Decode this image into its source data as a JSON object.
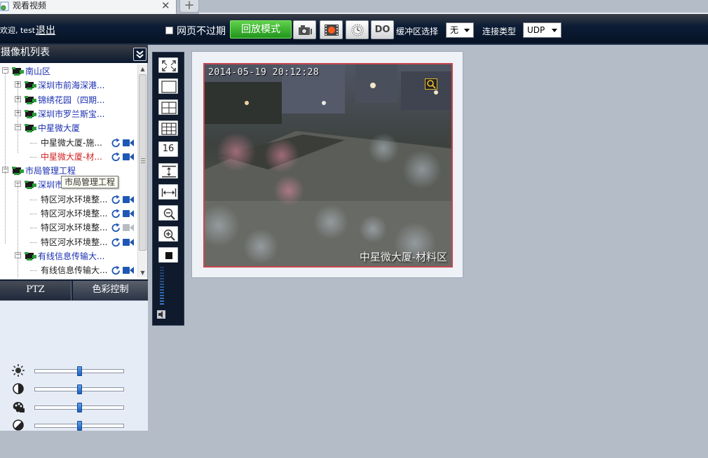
{
  "browser": {
    "tab_title": "观看视频",
    "tab_close": "✕",
    "new_tab": "+"
  },
  "toolbar": {
    "welcome": "欢迎, test",
    "logout": "退出",
    "no_expire_label": "网页不过期",
    "no_expire_checked": false,
    "playback_button": "回放模式",
    "do_button": "DO",
    "buffer_label": "缓冲区选择",
    "buffer_value": "无",
    "connection_label": "连接类型",
    "connection_value": "UDP",
    "buttons": [
      "snapshot-icon",
      "record-icon",
      "clock-icon",
      "do-icon"
    ],
    "accent_green": "#2fae28"
  },
  "camera_panel": {
    "title": "摄像机列表",
    "tree": [
      {
        "label": "南山区",
        "level": 0,
        "expanded": true,
        "color": "blue"
      },
      {
        "label": "深圳市前海深港...",
        "level": 1,
        "expanded": false,
        "color": "blue"
      },
      {
        "label": "锦绣花园（四期...",
        "level": 1,
        "expanded": false,
        "color": "blue"
      },
      {
        "label": "深圳市罗兰斯宝...",
        "level": 1,
        "expanded": false,
        "color": "blue"
      },
      {
        "label": "中星微大厦",
        "level": 1,
        "expanded": true,
        "color": "blue"
      },
      {
        "label": "中星微大厦-施...",
        "level": 2,
        "camera": true,
        "status": "online",
        "color": "dark"
      },
      {
        "label": "中星微大厦-材...",
        "level": 2,
        "camera": true,
        "status": "online",
        "color": "red"
      },
      {
        "label": "市局管理工程",
        "level": 0,
        "expanded": true,
        "color": "blue"
      },
      {
        "label": "深圳市",
        "level": 1,
        "expanded": true,
        "color": "blue"
      },
      {
        "label": "特区河水环境整...",
        "level": 2,
        "camera": true,
        "status": "online",
        "color": "dark"
      },
      {
        "label": "特区河水环境整...",
        "level": 2,
        "camera": true,
        "status": "online",
        "color": "dark"
      },
      {
        "label": "特区河水环境整...",
        "level": 2,
        "camera": true,
        "status": "offline",
        "color": "dark"
      },
      {
        "label": "特区河水环境整...",
        "level": 2,
        "camera": true,
        "status": "online",
        "color": "dark"
      },
      {
        "label": "有线信息传输大...",
        "level": 1,
        "expanded": true,
        "color": "blue"
      },
      {
        "label": "有线信息传输大...",
        "level": 2,
        "camera": true,
        "status": "online",
        "color": "dark"
      }
    ],
    "tooltip": "市局管理工程"
  },
  "control_tabs": {
    "ptz": "PTZ",
    "color": "色彩控制"
  },
  "color_controls": [
    {
      "name": "brightness",
      "icon": "sun-icon",
      "value": 0.5
    },
    {
      "name": "contrast",
      "icon": "contrast-icon",
      "value": 0.5
    },
    {
      "name": "saturation",
      "icon": "palette-icon",
      "value": 0.5
    },
    {
      "name": "hue",
      "icon": "hue-icon",
      "value": 0.5
    }
  ],
  "view_controls": {
    "buttons": [
      {
        "icon": "fullscreen-icon"
      },
      {
        "icon": "layout-1-icon"
      },
      {
        "icon": "layout-4-icon"
      },
      {
        "icon": "layout-9-icon"
      },
      {
        "icon": "layout-16-icon",
        "label": "16"
      },
      {
        "icon": "fit-vertical-icon"
      },
      {
        "icon": "fit-horizontal-icon"
      },
      {
        "icon": "zoom-out-icon"
      },
      {
        "icon": "zoom-in-icon"
      },
      {
        "icon": "stop-icon"
      }
    ]
  },
  "video": {
    "timestamp": "2014-05-19 20:12:28",
    "caption": "中星微大厦-材料区",
    "border_color": "#c8484e"
  }
}
